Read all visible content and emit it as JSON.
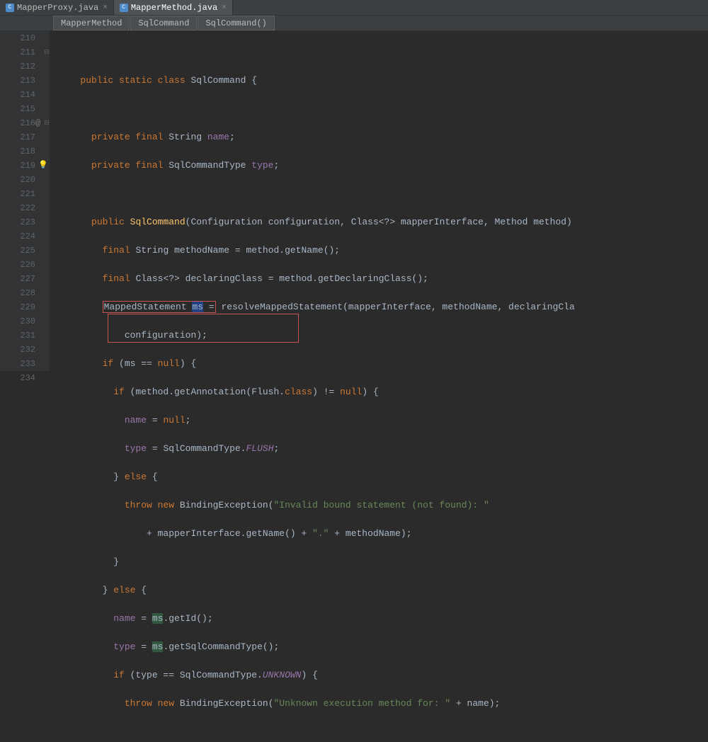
{
  "tabs": [
    {
      "label": "MapperProxy.java",
      "active": false
    },
    {
      "label": "MapperMethod.java",
      "active": true
    }
  ],
  "breadcrumb": [
    {
      "label": "MapperMethod"
    },
    {
      "label": "SqlCommand"
    },
    {
      "label": "SqlCommand()"
    }
  ],
  "lines": {
    "start": 210,
    "end": 234
  },
  "code": {
    "l211": {
      "kw1": "public static class",
      "name": "SqlCommand",
      "brace": " {"
    },
    "l213": {
      "kw": "private final",
      "type": "String",
      "name": "name",
      "semi": ";"
    },
    "l214": {
      "kw": "private final",
      "type": "SqlCommandType",
      "name": "type",
      "semi": ";"
    },
    "l216": {
      "kw": "public",
      "ctor": "SqlCommand",
      "p1t": "Configuration",
      "p1n": "configuration",
      "p2t": "Class<?>",
      "p2n": "mapperInterface",
      "p3t": "Method",
      "p3n": "method"
    },
    "l217": {
      "kw": "final",
      "type": "String",
      "var": "methodName",
      "eq": " = ",
      "obj": "method",
      "call": ".getName();"
    },
    "l218": {
      "kw": "final",
      "type": "Class<?>",
      "var": "declaringClass",
      "eq": " = ",
      "obj": "method",
      "call": ".getDeclaringClass();"
    },
    "l219": {
      "type": "MappedStatement",
      "var": "ms",
      "eq": " = ",
      "call": "resolveMappedStatement",
      "args": "(mapperInterface, methodName, declaringCla"
    },
    "l220": {
      "arg": "configuration);"
    },
    "l221": {
      "kw": "if",
      "cond": " (ms == ",
      "nul": "null",
      "rest": ") {"
    },
    "l222": {
      "kw": "if",
      "pre": " (method.getAnnotation(",
      "cls": "Flush",
      "mid": ".",
      "kw2": "class",
      "post": ") != ",
      "nul": "null",
      "rest": ") {"
    },
    "l223": {
      "field": "name",
      "eq": " = ",
      "nul": "null",
      "semi": ";"
    },
    "l224": {
      "field": "type",
      "eq": " = SqlCommandType.",
      "val": "FLUSH",
      "semi": ";"
    },
    "l225": {
      "brace": "}",
      "kw": " else ",
      "brace2": "{"
    },
    "l226": {
      "kw1": "throw new",
      "type": "BindingException",
      "str": "\"Invalid bound statement (not found): \""
    },
    "l227": {
      "pre": "+ mapperInterface.getName() + ",
      "str": "\".\"",
      "post": " + methodName);"
    },
    "l228": {
      "brace": "}"
    },
    "l229": {
      "brace": "}",
      "kw": " else ",
      "brace2": "{"
    },
    "l230": {
      "field": "name",
      "eq": " = ",
      "var": "ms",
      "call": ".getId();"
    },
    "l231": {
      "field": "type",
      "eq": " = ",
      "var": "ms",
      "call": ".getSqlCommandType();"
    },
    "l232": {
      "kw": "if",
      "cond": " (type == SqlCommandType.",
      "val": "UNKNOWN",
      "rest": ") {"
    },
    "l233": {
      "kw1": "throw new",
      "type": "BindingException",
      "str": "\"Unknown execution method for: \"",
      "post": " + name);"
    }
  }
}
